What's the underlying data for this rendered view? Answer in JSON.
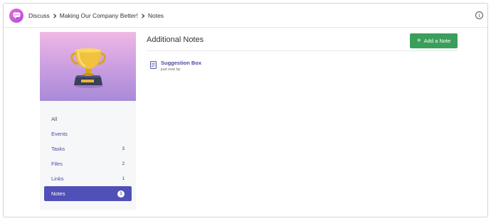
{
  "header": {
    "logo_icon": "chat-bubble-icon",
    "breadcrumb": [
      "Discuss",
      "Making Our Company Better!",
      "Notes"
    ],
    "info_icon": "info-icon",
    "info_glyph": "i"
  },
  "sidebar": {
    "hero_icon": "trophy-icon",
    "items": [
      {
        "label": "All",
        "count": ""
      },
      {
        "label": "Events",
        "count": ""
      },
      {
        "label": "Tasks",
        "count": "3"
      },
      {
        "label": "Files",
        "count": "2"
      },
      {
        "label": "Links",
        "count": "1"
      },
      {
        "label": "Notes",
        "count": "1",
        "active": true
      }
    ]
  },
  "main": {
    "title": "Additional Notes",
    "add_button": {
      "plus": "+",
      "label": "Add a Note"
    },
    "notes": [
      {
        "title": "Suggestion Box",
        "meta": "just now by",
        "icon": "note-icon"
      }
    ]
  },
  "colors": {
    "accent": "#5050b8",
    "link": "#4a4aa0",
    "add_button": "#3a9f5a",
    "hero_top": "#f0b8e4",
    "hero_bottom": "#a98ad8"
  }
}
